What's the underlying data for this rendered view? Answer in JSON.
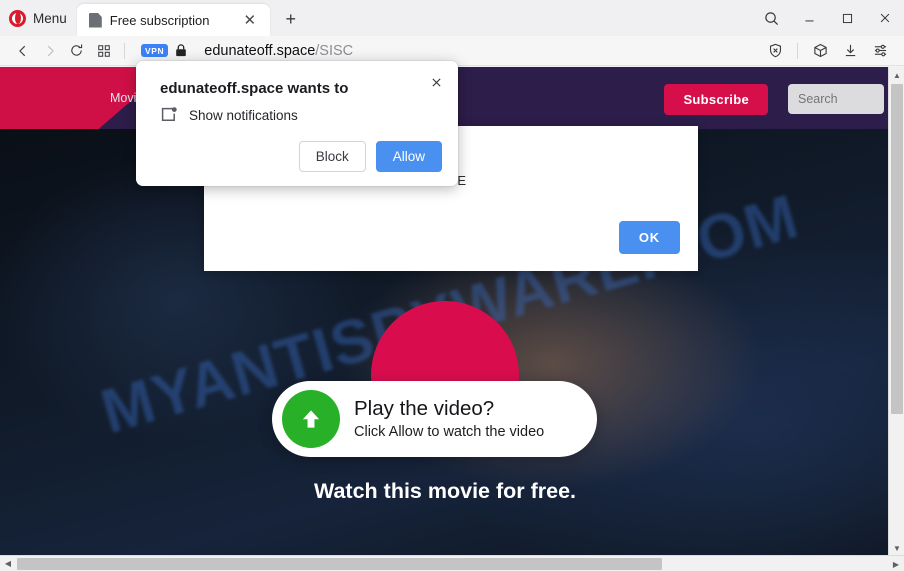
{
  "browser": {
    "menu_label": "Menu",
    "tab": {
      "title": "Free subscription",
      "close_glyph": "✕",
      "favicon": "page-icon"
    },
    "new_tab_glyph": "+",
    "window_controls": {
      "search": "search-icon",
      "minimize": "—",
      "maximize": "▢",
      "close": "✕"
    },
    "nav": {
      "back_glyph": "‹",
      "forward_glyph": "›",
      "reload_glyph": "⟳",
      "speeddial_glyph": "▦"
    },
    "address": {
      "vpn_badge": "VPN",
      "lock_glyph": "🔒",
      "host": "edunateoff.space",
      "path": "/SISC"
    },
    "toolbar_icons": [
      "shield-block-icon",
      "extensions-cube-icon",
      "downloads-icon",
      "easy-setup-icon"
    ]
  },
  "site": {
    "nav_items": [
      "Movies"
    ],
    "subscribe_label": "Subscribe",
    "search_placeholder": "Search",
    "colors": {
      "header_bg": "#2d1d4a",
      "wedge": "#cf1046",
      "accent": "#d60e49"
    },
    "hero": {
      "play_title": "Play the video?",
      "play_subtitle": "Click Allow to watch the video",
      "tagline": "Watch this movie for free.",
      "play_icon": "green-up-arrow-icon"
    },
    "watermark": "MYANTISPYWARE.COM",
    "dialog": {
      "visible_text": "E",
      "ok_label": "OK"
    }
  },
  "permission_popup": {
    "title": "edunateoff.space wants to",
    "permission": "Show notifications",
    "permission_icon": "notification-icon",
    "close_glyph": "✕",
    "block_label": "Block",
    "allow_label": "Allow",
    "allow_color": "#4a90f0"
  },
  "scrollbars": {
    "v_up_glyph": "▲",
    "v_down_glyph": "▼",
    "h_left_glyph": "◀",
    "h_right_glyph": "▶"
  }
}
